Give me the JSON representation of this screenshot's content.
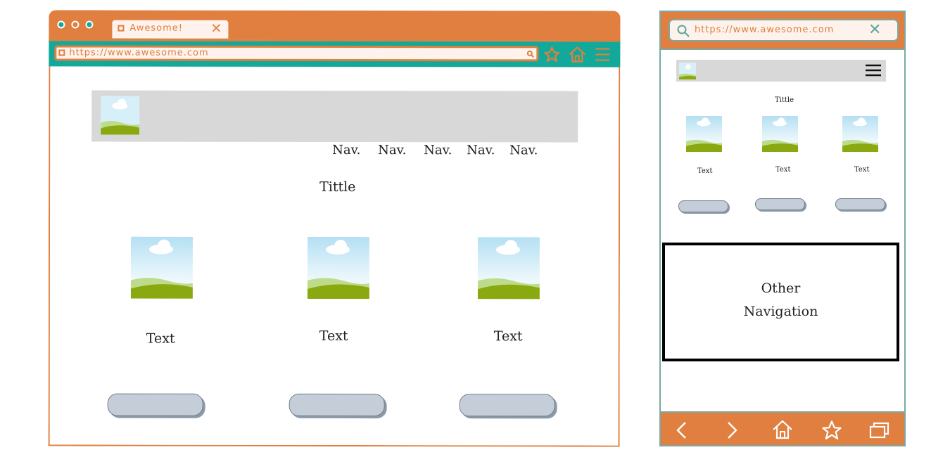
{
  "colors": {
    "accent": "#e07f3f",
    "toolbar": "#12a99a",
    "header_gray": "#d8d8d8",
    "button_gray": "#c5ced8",
    "mobile_border": "#7aa9a5"
  },
  "desktop": {
    "tab": {
      "title": "Awesome!",
      "close_icon": "close-icon"
    },
    "address_bar": {
      "url": "https://www.awesome.com",
      "icons": [
        "page-icon",
        "search-icon"
      ]
    },
    "toolbar_icons": [
      "star-icon",
      "home-icon",
      "menu-icon"
    ],
    "nav_items": [
      "Nav.",
      "Nav.",
      "Nav.",
      "Nav.",
      "Nav."
    ],
    "title": "Tittle",
    "cards": [
      {
        "text": "Text",
        "icon": "image-placeholder-icon"
      },
      {
        "text": "Text",
        "icon": "image-placeholder-icon"
      },
      {
        "text": "Text",
        "icon": "image-placeholder-icon"
      }
    ]
  },
  "mobile": {
    "address_bar": {
      "url": "https://www.awesome.com",
      "icons": [
        "search-icon",
        "close-icon"
      ]
    },
    "header_icons": [
      "image-placeholder-icon",
      "hamburger-menu-icon"
    ],
    "title": "Tittle",
    "cards": [
      {
        "text": "Text",
        "icon": "image-placeholder-icon"
      },
      {
        "text": "Text",
        "icon": "image-placeholder-icon"
      },
      {
        "text": "Text",
        "icon": "image-placeholder-icon"
      }
    ],
    "other_navigation": {
      "line1": "Other",
      "line2": "Navigation"
    },
    "bottom_bar_icons": [
      "back-icon",
      "forward-icon",
      "home-icon",
      "star-icon",
      "tabs-icon"
    ]
  }
}
